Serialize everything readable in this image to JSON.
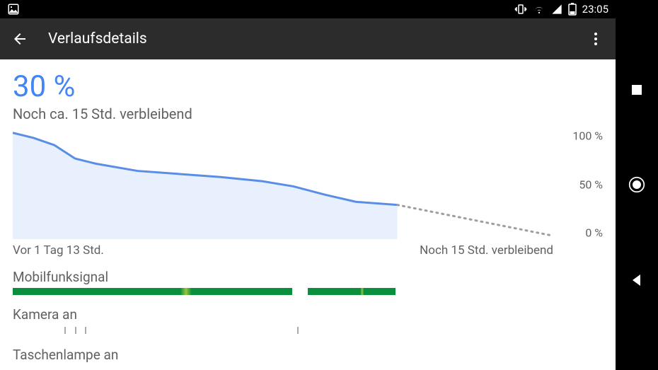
{
  "status_bar": {
    "time": "23:05"
  },
  "app_bar": {
    "title": "Verlaufsdetails"
  },
  "battery": {
    "percent_label": "30 %",
    "remaining_label": "Noch ca. 15 Std. verbleibend"
  },
  "chart_data": {
    "type": "line",
    "title": "",
    "xlabel": "",
    "ylabel": "",
    "ylim": [
      0,
      100
    ],
    "x_range_hours": {
      "past": 37,
      "future": 15,
      "total": 52
    },
    "y_ticks": [
      "100 %",
      "50 %",
      "0 %"
    ],
    "x_left_label": "Vor 1 Tag 13 Std.",
    "x_right_label": "Noch 15 Std. verbleibend",
    "series": [
      {
        "name": "actual",
        "style": "solid",
        "points": [
          {
            "h": 0,
            "pct": 100
          },
          {
            "h": 2,
            "pct": 95
          },
          {
            "h": 4,
            "pct": 88
          },
          {
            "h": 6,
            "pct": 75
          },
          {
            "h": 8,
            "pct": 70
          },
          {
            "h": 12,
            "pct": 63
          },
          {
            "h": 16,
            "pct": 60
          },
          {
            "h": 20,
            "pct": 57
          },
          {
            "h": 24,
            "pct": 53
          },
          {
            "h": 27,
            "pct": 48
          },
          {
            "h": 30,
            "pct": 40
          },
          {
            "h": 33,
            "pct": 33
          },
          {
            "h": 37,
            "pct": 30
          }
        ]
      },
      {
        "name": "projected",
        "style": "dotted",
        "points": [
          {
            "h": 37,
            "pct": 30
          },
          {
            "h": 52,
            "pct": 0
          }
        ]
      }
    ]
  },
  "sections": {
    "mobilfunksignal": {
      "label": "Mobilfunksignal"
    },
    "kamera": {
      "label": "Kamera an"
    },
    "taschenlampe": {
      "label": "Taschenlampe an"
    }
  },
  "signal_bar": {
    "segments": [
      {
        "start_h": 0,
        "end_h": 27
      },
      {
        "start_h": 28.5,
        "end_h": 37
      }
    ]
  },
  "kamera_marks_h": [
    5,
    6,
    7,
    27.5
  ]
}
